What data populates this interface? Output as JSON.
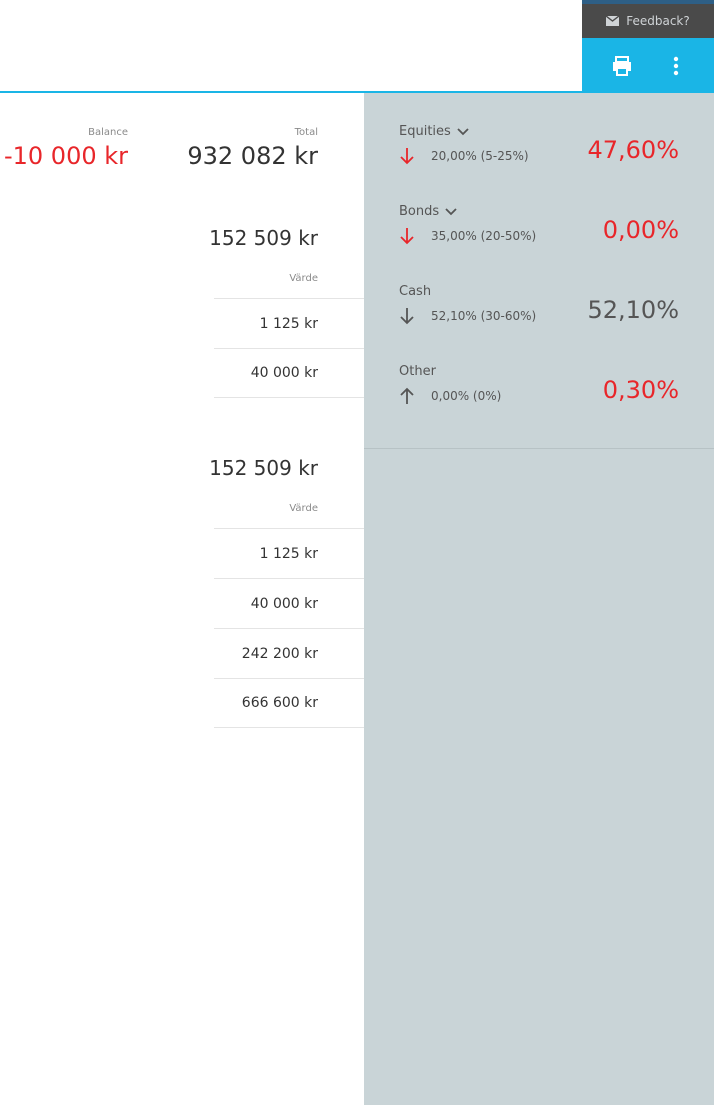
{
  "header": {
    "feedback_label": "Feedback?",
    "accent_color": "#1ab5e6"
  },
  "summary": {
    "balance_label": "Balance",
    "balance_value": "-10 000 kr",
    "total_label": "Total",
    "total_value": "932 082 kr"
  },
  "sections": [
    {
      "value": "152 509 kr",
      "column_header": "Värde",
      "rows": [
        "1 125 kr",
        "40 000 kr"
      ]
    },
    {
      "value": "152 509 kr",
      "column_header": "Värde",
      "rows": [
        "1 125 kr",
        "40 000 kr",
        "242 200 kr",
        "666 600 kr"
      ]
    }
  ],
  "allocation": [
    {
      "name": "Equities",
      "expandable": true,
      "direction": "down",
      "target": "20,00% (5-25%)",
      "actual": "47,60%",
      "status": "warning"
    },
    {
      "name": "Bonds",
      "expandable": true,
      "direction": "down",
      "target": "35,00% (20-50%)",
      "actual": "0,00%",
      "status": "warning"
    },
    {
      "name": "Cash",
      "expandable": false,
      "direction": "down",
      "target": "52,10% (30-60%)",
      "actual": "52,10%",
      "status": "ok"
    },
    {
      "name": "Other",
      "expandable": false,
      "direction": "up",
      "target": "0,00% (0%)",
      "actual": "0,30%",
      "status": "warning"
    }
  ]
}
